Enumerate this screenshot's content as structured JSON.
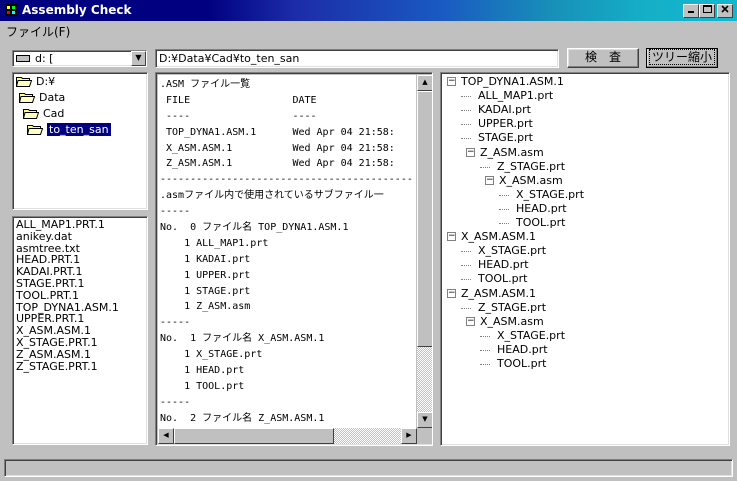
{
  "window": {
    "title": "Assembly Check"
  },
  "menu": {
    "file": "ファイル(F)"
  },
  "drive": {
    "value": "d: ["
  },
  "path": {
    "value": "D:¥Data¥Cad¥to_ten_san"
  },
  "buttons": {
    "check": "検　査",
    "tree_shrink": "ツリー縮小"
  },
  "folders": [
    {
      "label": "D:¥",
      "selected": false
    },
    {
      "label": "Data",
      "selected": false
    },
    {
      "label": "Cad",
      "selected": false
    },
    {
      "label": "to_ten_san",
      "selected": true
    }
  ],
  "files": [
    "ALL_MAP1.PRT.1",
    "anikey.dat",
    "asmtree.txt",
    "HEAD.PRT.1",
    "KADAI.PRT.1",
    "STAGE.PRT.1",
    "TOOL.PRT.1",
    "TOP_DYNA1.ASM.1",
    "UPPER.PRT.1",
    "X_ASM.ASM.1",
    "X_STAGE.PRT.1",
    "Z_ASM.ASM.1",
    "Z_STAGE.PRT.1"
  ],
  "report_lines": [
    ".ASM ファイル一覧",
    " FILE                 DATE",
    " ----                 ----",
    " TOP_DYNA1.ASM.1      Wed Apr 04 21:58:",
    " X_ASM.ASM.1          Wed Apr 04 21:58:",
    " Z_ASM.ASM.1          Wed Apr 04 21:58:",
    "------------------------------------------",
    ".asmファイル内で使用されているサブファイル一",
    "-----",
    "No.  0 ファイル名 TOP_DYNA1.ASM.1",
    "    1 ALL_MAP1.prt",
    "    1 KADAI.prt",
    "    1 UPPER.prt",
    "    1 STAGE.prt",
    "    1 Z_ASM.asm",
    "-----",
    "No.  1 ファイル名 X_ASM.ASM.1",
    "    1 X_STAGE.prt",
    "    1 HEAD.prt",
    "    1 TOOL.prt",
    "-----",
    "No.  2 ファイル名 Z_ASM.ASM.1"
  ],
  "tree": [
    {
      "label": "TOP_DYNA1.ASM.1",
      "level": 0,
      "expander": "−"
    },
    {
      "label": "ALL_MAP1.prt",
      "level": 1,
      "expander": ""
    },
    {
      "label": "KADAI.prt",
      "level": 1,
      "expander": ""
    },
    {
      "label": "UPPER.prt",
      "level": 1,
      "expander": ""
    },
    {
      "label": "STAGE.prt",
      "level": 1,
      "expander": ""
    },
    {
      "label": "Z_ASM.asm",
      "level": 1,
      "expander": "−"
    },
    {
      "label": "Z_STAGE.prt",
      "level": 2,
      "expander": ""
    },
    {
      "label": "X_ASM.asm",
      "level": 2,
      "expander": "−"
    },
    {
      "label": "X_STAGE.prt",
      "level": 3,
      "expander": ""
    },
    {
      "label": "HEAD.prt",
      "level": 3,
      "expander": ""
    },
    {
      "label": "TOOL.prt",
      "level": 3,
      "expander": ""
    },
    {
      "label": "X_ASM.ASM.1",
      "level": 0,
      "expander": "−"
    },
    {
      "label": "X_STAGE.prt",
      "level": 1,
      "expander": ""
    },
    {
      "label": "HEAD.prt",
      "level": 1,
      "expander": ""
    },
    {
      "label": "TOOL.prt",
      "level": 1,
      "expander": ""
    },
    {
      "label": "Z_ASM.ASM.1",
      "level": 0,
      "expander": "−"
    },
    {
      "label": "Z_STAGE.prt",
      "level": 1,
      "expander": ""
    },
    {
      "label": "X_ASM.asm",
      "level": 1,
      "expander": "−"
    },
    {
      "label": "X_STAGE.prt",
      "level": 2,
      "expander": ""
    },
    {
      "label": "HEAD.prt",
      "level": 2,
      "expander": ""
    },
    {
      "label": "TOOL.prt",
      "level": 2,
      "expander": ""
    }
  ],
  "colors": {
    "selection": "#000080",
    "face": "#c0c0c0"
  }
}
